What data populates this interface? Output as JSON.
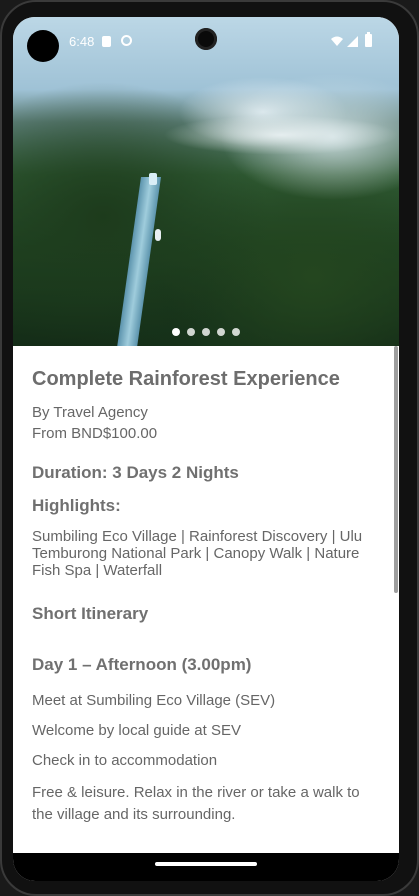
{
  "status_bar": {
    "time": "6:48"
  },
  "carousel": {
    "page_count": 5,
    "active_index": 0
  },
  "tour": {
    "title": "Complete Rainforest Experience",
    "agency": "By Travel Agency",
    "price": "From BND$100.00",
    "duration": "Duration: 3 Days 2 Nights",
    "highlights_heading": "Highlights:",
    "highlights_text": "Sumbiling Eco Village | Rainforest Discovery | Ulu Temburong National Park | Canopy Walk | Nature Fish Spa | Waterfall",
    "itinerary_heading": "Short Itinerary",
    "day1_heading": "Day 1 – Afternoon (3.00pm)",
    "day1_items": [
      "Meet at Sumbiling Eco Village (SEV)",
      "Welcome by local guide at SEV",
      "Check in to accommodation",
      "Free & leisure. Relax in the river or take a walk to the village and its surrounding."
    ]
  }
}
